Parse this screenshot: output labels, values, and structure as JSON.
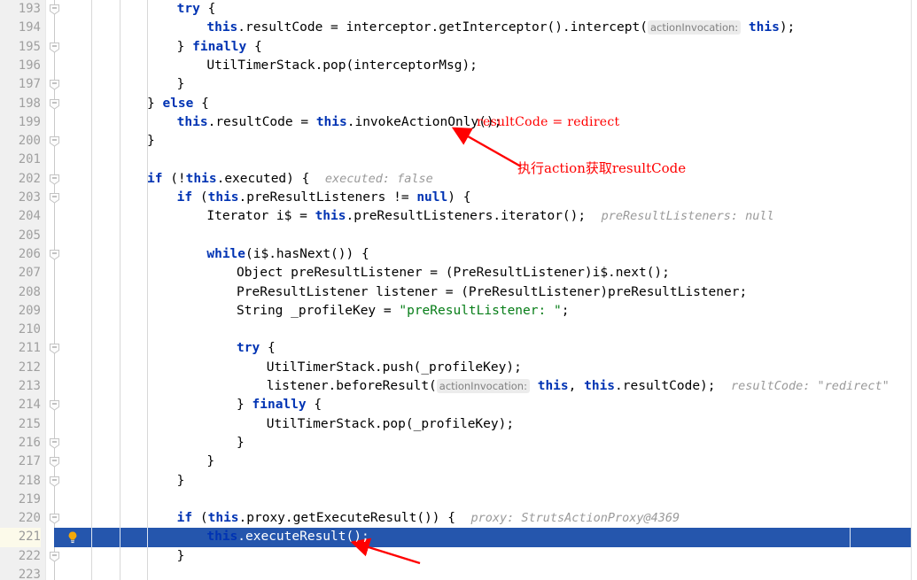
{
  "editor": {
    "first_line": 193,
    "current_line": 221,
    "gutter_icon": "lightbulb-icon",
    "colors": {
      "current_line_highlight": "#2556ad",
      "keyword": "#0033b3",
      "string": "#067d17",
      "inline_hint": "#9a9a9a",
      "annotation": "#ff0000",
      "gutter_background": "#f0f0f0"
    }
  },
  "lines": [
    {
      "n": 193,
      "fold": true,
      "indent": 26,
      "text": "try {"
    },
    {
      "n": 194,
      "fold": false,
      "indent": 30,
      "text": "this.resultCode = interceptor.getInterceptor().intercept( actionInvocation: this);"
    },
    {
      "n": 195,
      "fold": true,
      "indent": 26,
      "text": "} finally {"
    },
    {
      "n": 196,
      "fold": false,
      "indent": 30,
      "text": "UtilTimerStack.pop(interceptorMsg);"
    },
    {
      "n": 197,
      "fold": true,
      "indent": 26,
      "text": "}"
    },
    {
      "n": 198,
      "fold": true,
      "indent": 22,
      "text": "} else {"
    },
    {
      "n": 199,
      "fold": false,
      "indent": 26,
      "text": "this.resultCode = this.invokeActionOnly();"
    },
    {
      "n": 200,
      "fold": true,
      "indent": 22,
      "text": "}"
    },
    {
      "n": 201,
      "fold": false,
      "indent": 0,
      "text": ""
    },
    {
      "n": 202,
      "fold": true,
      "indent": 22,
      "text": "if (!this.executed) {   executed: false"
    },
    {
      "n": 203,
      "fold": true,
      "indent": 26,
      "text": "if (this.preResultListeners != null) {"
    },
    {
      "n": 204,
      "fold": false,
      "indent": 30,
      "text": "Iterator i$ = this.preResultListeners.iterator();   preResultListeners: null"
    },
    {
      "n": 205,
      "fold": false,
      "indent": 0,
      "text": ""
    },
    {
      "n": 206,
      "fold": true,
      "indent": 30,
      "text": "while(i$.hasNext()) {"
    },
    {
      "n": 207,
      "fold": false,
      "indent": 34,
      "text": "Object preResultListener = (PreResultListener)i$.next();"
    },
    {
      "n": 208,
      "fold": false,
      "indent": 34,
      "text": "PreResultListener listener = (PreResultListener)preResultListener;"
    },
    {
      "n": 209,
      "fold": false,
      "indent": 34,
      "text": "String _profileKey = \"preResultListener: \";"
    },
    {
      "n": 210,
      "fold": false,
      "indent": 0,
      "text": ""
    },
    {
      "n": 211,
      "fold": true,
      "indent": 34,
      "text": "try {"
    },
    {
      "n": 212,
      "fold": false,
      "indent": 38,
      "text": "UtilTimerStack.push(_profileKey);"
    },
    {
      "n": 213,
      "fold": false,
      "indent": 38,
      "text": "listener.beforeResult( actionInvocation: this, this.resultCode);   resultCode: \"redirect\""
    },
    {
      "n": 214,
      "fold": true,
      "indent": 34,
      "text": "} finally {"
    },
    {
      "n": 215,
      "fold": false,
      "indent": 38,
      "text": "UtilTimerStack.pop(_profileKey);"
    },
    {
      "n": 216,
      "fold": true,
      "indent": 34,
      "text": "}"
    },
    {
      "n": 217,
      "fold": true,
      "indent": 30,
      "text": "}"
    },
    {
      "n": 218,
      "fold": true,
      "indent": 26,
      "text": "}"
    },
    {
      "n": 219,
      "fold": false,
      "indent": 0,
      "text": ""
    },
    {
      "n": 220,
      "fold": true,
      "indent": 26,
      "text": "if (this.proxy.getExecuteResult()) {   proxy: StrutsActionProxy@4369"
    },
    {
      "n": 221,
      "fold": false,
      "indent": 30,
      "text": "this.executeResult();"
    },
    {
      "n": 222,
      "fold": true,
      "indent": 26,
      "text": "}"
    },
    {
      "n": 223,
      "fold": false,
      "indent": 0,
      "text": ""
    }
  ],
  "inline_hints": {
    "line194_param": "actionInvocation:",
    "line202_value": "executed: false",
    "line204_value": "preResultListeners: null",
    "line213_param": "actionInvocation:",
    "line213_value": "resultCode: \"redirect\"",
    "line220_value": "proxy: StrutsActionProxy@4369"
  },
  "annotations": {
    "result_code_label": "resultCode = redirect",
    "chinese_note": "执行action获取resultCode"
  }
}
